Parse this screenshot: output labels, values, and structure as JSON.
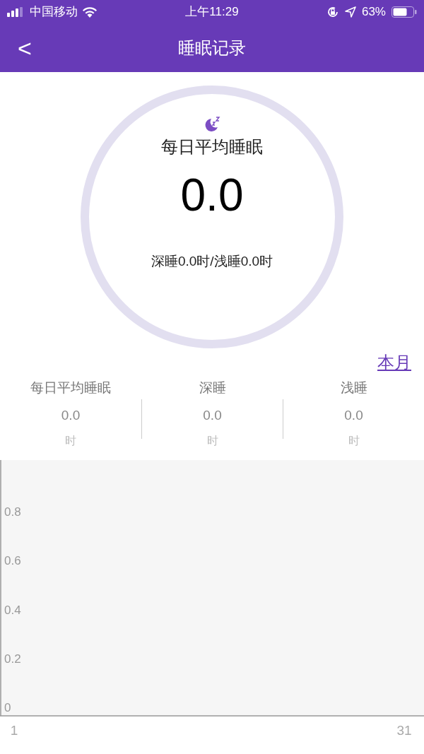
{
  "status_bar": {
    "carrier": "中国移动",
    "time": "上午11:29",
    "battery": "63%"
  },
  "nav": {
    "back": "<",
    "title": "睡眠记录"
  },
  "summary": {
    "label": "每日平均睡眠",
    "value": "0.0",
    "detail": "深睡0.0时/浅睡0.0时"
  },
  "period_link": "本月",
  "stats": [
    {
      "label": "每日平均睡眠",
      "value": "0.0",
      "unit": "时"
    },
    {
      "label": "深睡",
      "value": "0.0",
      "unit": "时"
    },
    {
      "label": "浅睡",
      "value": "0.0",
      "unit": "时"
    }
  ],
  "chart": {
    "chart_data": {
      "type": "line",
      "xlim": [
        -0.087,
        32.52
      ],
      "ylim": [
        -0.035,
        1.012
      ],
      "xticks": [
        1,
        31
      ],
      "yticks": [
        0,
        0.2,
        0.4,
        0.6,
        0.8
      ]
    }
  }
}
